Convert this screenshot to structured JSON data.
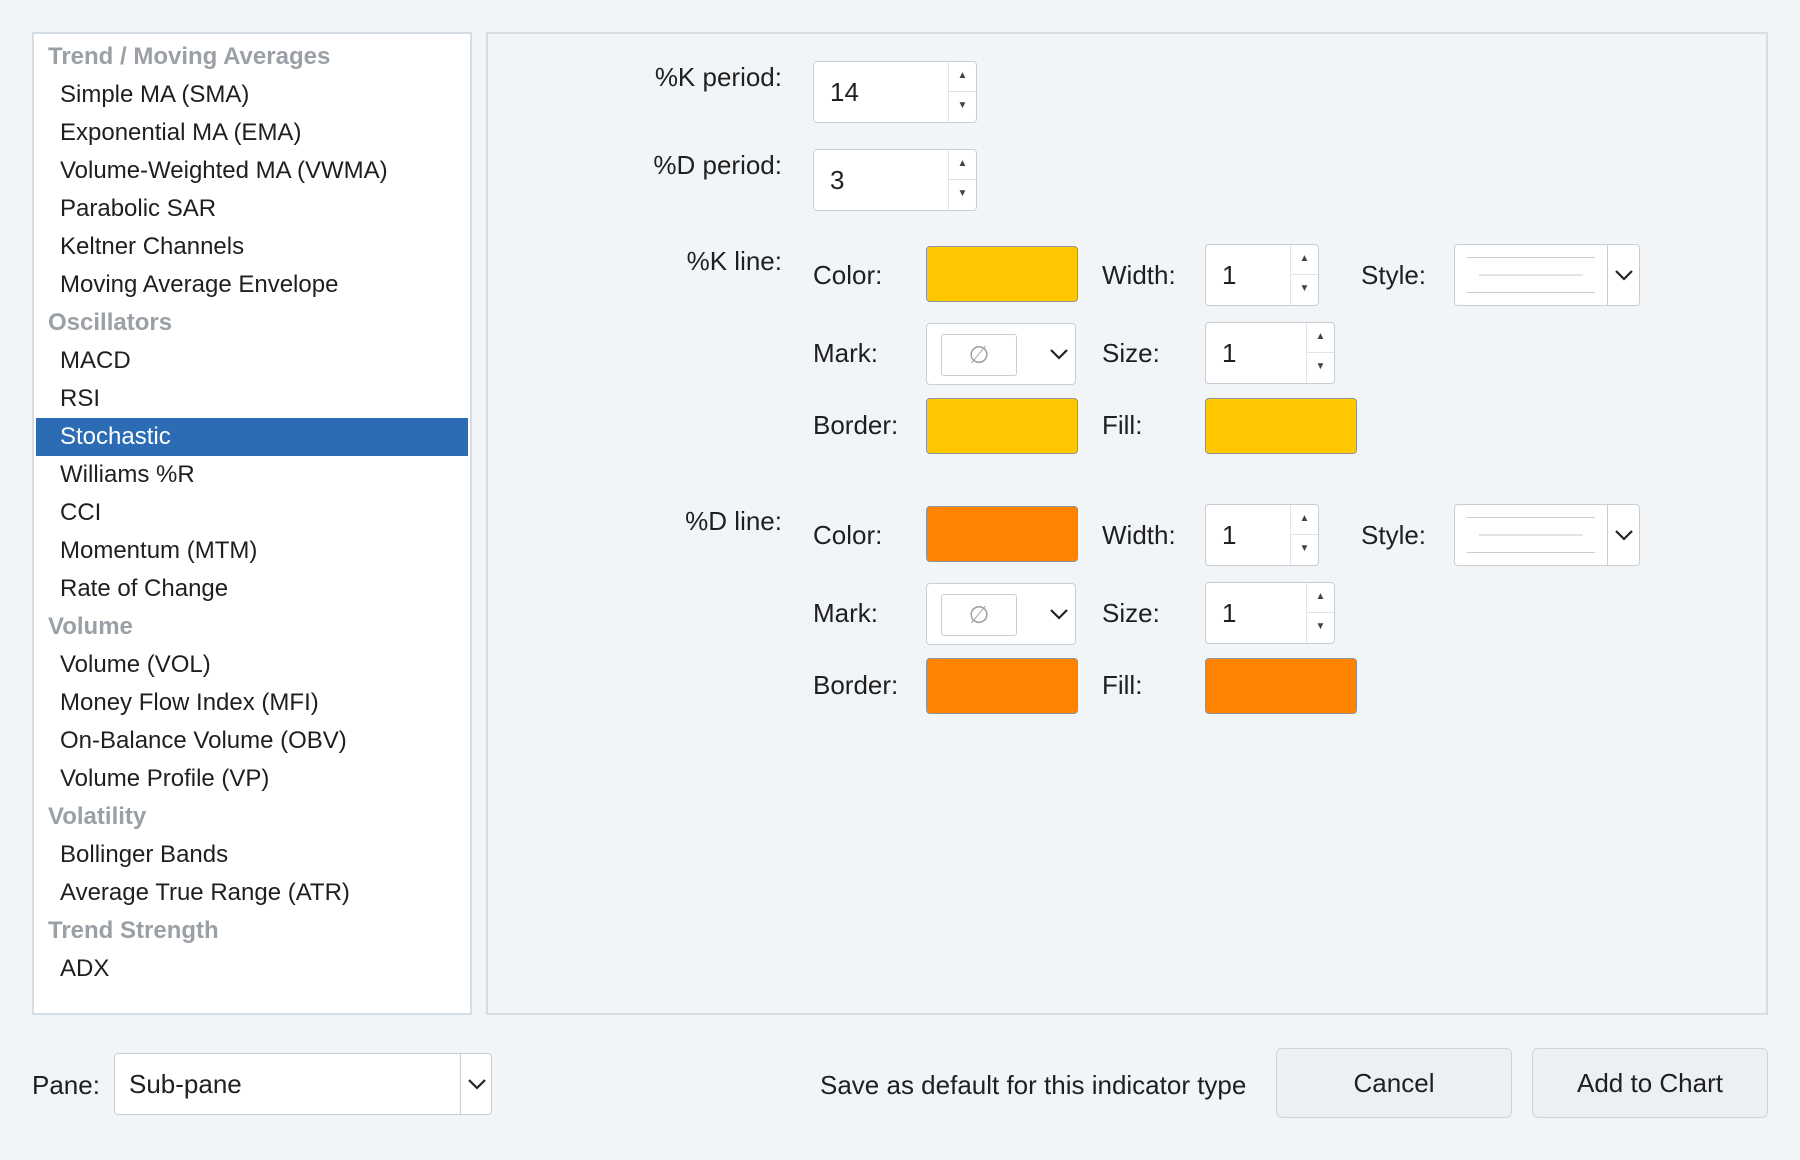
{
  "indicator_list": {
    "groups": [
      {
        "category": "Trend / Moving Averages",
        "items": [
          "Simple MA (SMA)",
          "Exponential MA (EMA)",
          "Volume-Weighted MA (VWMA)",
          "Parabolic SAR",
          "Keltner Channels",
          "Moving Average Envelope"
        ]
      },
      {
        "category": "Oscillators",
        "items": [
          "MACD",
          "RSI",
          "Stochastic",
          "Williams %R",
          "CCI",
          "Momentum (MTM)",
          "Rate of Change"
        ]
      },
      {
        "category": "Volume",
        "items": [
          "Volume (VOL)",
          "Money Flow Index (MFI)",
          "On-Balance Volume (OBV)",
          "Volume Profile (VP)"
        ]
      },
      {
        "category": "Volatility",
        "items": [
          "Bollinger Bands",
          "Average True Range (ATR)"
        ]
      },
      {
        "category": "Trend Strength",
        "items": [
          "ADX"
        ]
      }
    ],
    "selected": "Stochastic"
  },
  "settings": {
    "k_period": {
      "label": "%K period:",
      "value": "14"
    },
    "d_period": {
      "label": "%D period:",
      "value": "3"
    },
    "k_line": {
      "label": "%K line:",
      "color_label": "Color:",
      "color": "#ffc800",
      "width_label": "Width:",
      "width": "1",
      "style_label": "Style:",
      "mark_label": "Mark:",
      "mark_icon": "none-symbol-icon",
      "size_label": "Size:",
      "size": "1",
      "border_label": "Border:",
      "border_color": "#ffc800",
      "fill_label": "Fill:",
      "fill_color": "#ffc800"
    },
    "d_line": {
      "label": "%D line:",
      "color_label": "Color:",
      "color": "#ff8200",
      "width_label": "Width:",
      "width": "1",
      "style_label": "Style:",
      "mark_label": "Mark:",
      "mark_icon": "none-symbol-icon",
      "size_label": "Size:",
      "size": "1",
      "border_label": "Border:",
      "border_color": "#ff8200",
      "fill_label": "Fill:",
      "fill_color": "#ff8200"
    }
  },
  "footer": {
    "pane_label": "Pane:",
    "pane_value": "Sub-pane",
    "save_default_label": "Save as default for this indicator type",
    "cancel_label": "Cancel",
    "add_label": "Add to Chart"
  },
  "colors": {
    "selection": "#2b6cb5",
    "category_text": "#9aa0a6",
    "background": "#f2f5f8"
  }
}
